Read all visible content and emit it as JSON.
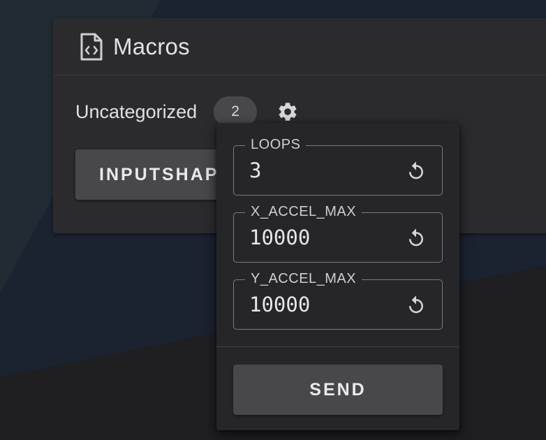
{
  "card": {
    "title": "Macros",
    "title_icon": "file-code-icon"
  },
  "category": {
    "label": "Uncategorized",
    "count": "2",
    "settings_icon": "gear-icon"
  },
  "macro_button": {
    "label": "INPUTSHAPER"
  },
  "popup": {
    "fields": [
      {
        "label": "LOOPS",
        "value": "3",
        "reset_icon": "reset-icon"
      },
      {
        "label": "X_ACCEL_MAX",
        "value": "10000",
        "reset_icon": "reset-icon"
      },
      {
        "label": "Y_ACCEL_MAX",
        "value": "10000",
        "reset_icon": "reset-icon"
      }
    ],
    "send_label": "SEND"
  },
  "colors": {
    "background": "#1f2022",
    "card": "#2b2b2d",
    "button": "#48484b",
    "text": "#e6e6e6"
  }
}
